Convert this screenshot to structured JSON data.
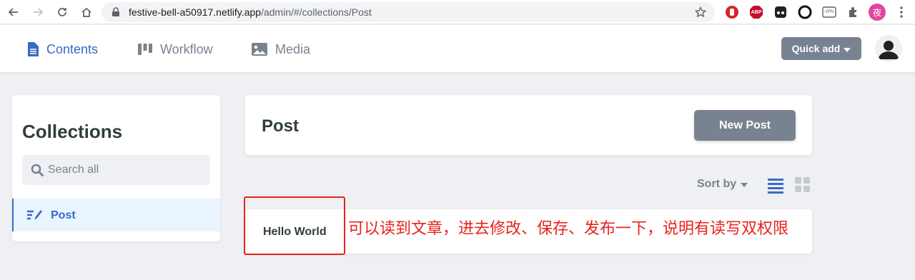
{
  "browser": {
    "url_host": "festive-bell-a50917.netlify.app",
    "url_path": "/admin/#/collections/Post",
    "profile_initial": "夜",
    "extensions": [
      "stop-icon",
      "abp-icon",
      "dots-icon",
      "circle-icon",
      "vpn-icon",
      "puzzle-icon"
    ],
    "abp_label": "ABP",
    "vpn_label": "VPN"
  },
  "header": {
    "tabs": [
      {
        "label": "Contents",
        "icon": "document-icon",
        "active": true
      },
      {
        "label": "Workflow",
        "icon": "kanban-icon",
        "active": false
      },
      {
        "label": "Media",
        "icon": "image-icon",
        "active": false
      }
    ],
    "quick_add_label": "Quick add"
  },
  "sidebar": {
    "title": "Collections",
    "search_placeholder": "Search all",
    "items": [
      {
        "label": "Post",
        "icon": "pen-list-icon",
        "active": true
      }
    ]
  },
  "main": {
    "title": "Post",
    "new_button_label": "New Post",
    "sort_label": "Sort by",
    "view_modes": [
      "list-view-icon",
      "grid-view-icon"
    ],
    "entries": [
      {
        "title": "Hello World"
      }
    ]
  },
  "annotation": {
    "text": "可以读到文章，进去修改、保存、发布一下，说明有读写双权限",
    "color": "#e8231c"
  },
  "colors": {
    "accent": "#3a69c7",
    "button_gray": "#798291",
    "background": "#eff0f4"
  }
}
